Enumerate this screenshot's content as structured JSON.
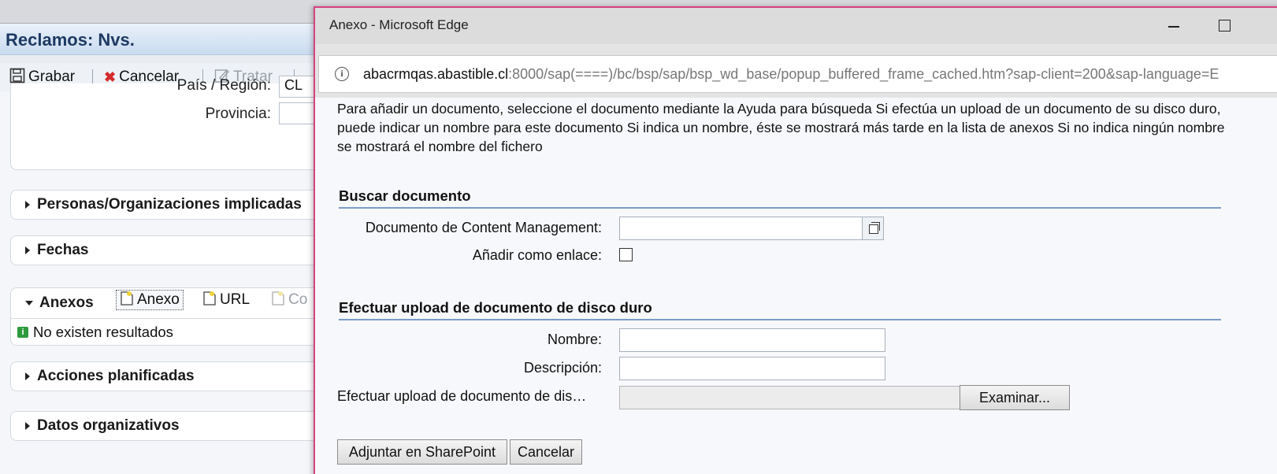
{
  "app": {
    "title": "Reclamos: Nvs.",
    "toolbar": {
      "grabar": "Grabar",
      "cancelar": "Cancelar",
      "tratar": "Tratar"
    },
    "fields": {
      "pais_label": "País / Región:",
      "pais_value": "CL",
      "provincia_label": "Provincia:"
    },
    "sections": {
      "personas": "Personas/Organizaciones implicadas",
      "fechas": "Fechas",
      "anexos": "Anexos",
      "acciones": "Acciones planificadas",
      "datos": "Datos organizativos"
    },
    "anexos_toolbar": {
      "anexo": "Anexo",
      "url": "URL",
      "co": "Co"
    },
    "no_results": "No existen resultados"
  },
  "popup": {
    "window_title": "Anexo - Microsoft Edge",
    "url_host": "abacrmqas.abastible.cl",
    "url_path": ":8000/sap(====)/bc/bsp/sap/bsp_wd_base/popup_buffered_frame_cached.htm?sap-client=200&sap-language=E",
    "intro_text": "Para añadir un documento, seleccione el documento mediante la Ayuda para búsqueda Si efectúa un upload de un documento de su disco duro, puede indicar un nombre para este documento Si indica un nombre, éste se mostrará más tarde en la lista de anexos Si no indica ningún nombre se mostrará el nombre del fichero",
    "buscar": {
      "heading": "Buscar documento",
      "doc_label": "Documento de Content Management:",
      "doc_value": "",
      "enlace_label": "Añadir como enlace:"
    },
    "upload": {
      "heading": "Efectuar upload de documento de disco duro",
      "nombre_label": "Nombre:",
      "nombre_value": "",
      "descripcion_label": "Descripción:",
      "descripcion_value": "",
      "file_label": "Efectuar upload de documento de dis…",
      "examinar": "Examinar..."
    },
    "buttons": {
      "adjuntar": "Adjuntar en SharePoint",
      "cancelar": "Cancelar"
    }
  }
}
